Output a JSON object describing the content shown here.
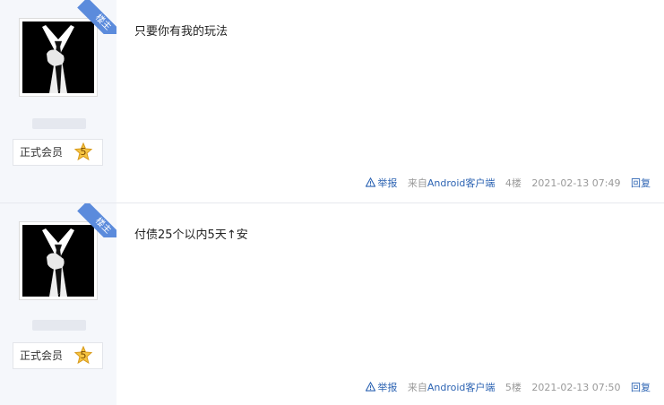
{
  "posts": [
    {
      "badge_ribbon": "楼主",
      "username": "",
      "member_label": "正式会员",
      "level": "5",
      "text": "只要你有我的玩法",
      "report_label": "举报",
      "client_prefix": "来自",
      "client_name": "Android客户端",
      "floor": "4楼",
      "time": "2021-02-13 07:49",
      "reply_label": "回复"
    },
    {
      "badge_ribbon": "楼主",
      "username": "",
      "member_label": "正式会员",
      "level": "5",
      "text": "付债25个以内5天↑安",
      "report_label": "举报",
      "client_prefix": "来自",
      "client_name": "Android客户端",
      "floor": "5楼",
      "time": "2021-02-13 07:50",
      "reply_label": "回复"
    }
  ],
  "colors": {
    "accent": "#2d64b3",
    "ribbon": "#5b8bdc",
    "sidebar": "#f5f7fb"
  },
  "icons": {
    "report": "warning-triangle-icon",
    "level": "star-badge-icon"
  }
}
